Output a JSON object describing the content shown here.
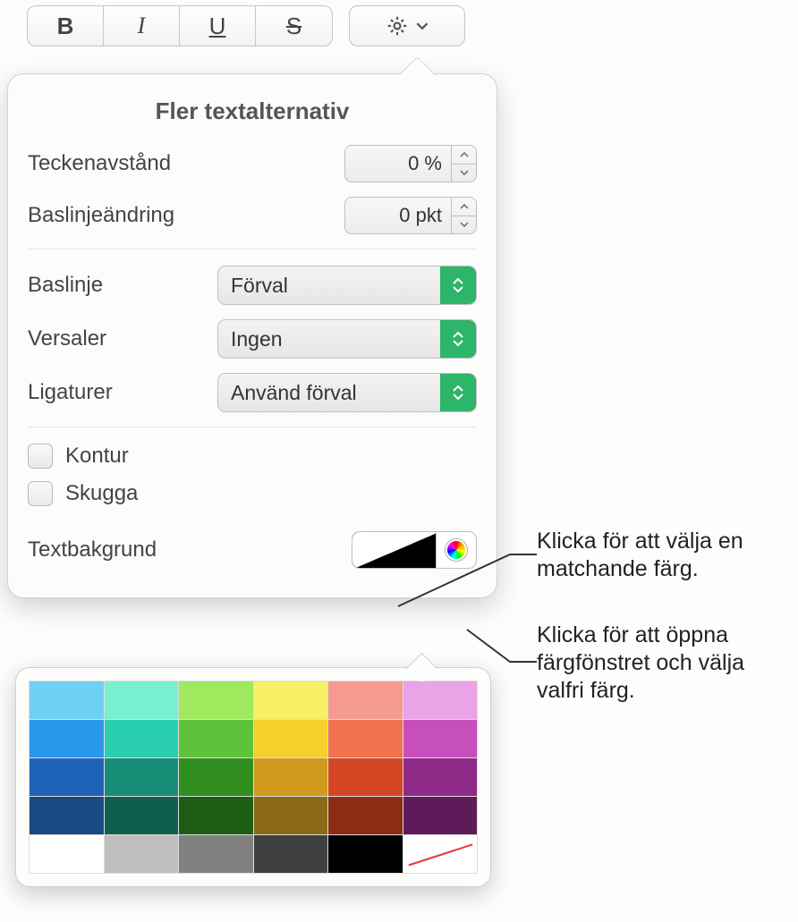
{
  "toolbar": {
    "bold_letter": "B",
    "italic_letter": "I",
    "underline_letter": "U",
    "strike_letter": "S"
  },
  "popover": {
    "title": "Fler textalternativ",
    "char_spacing_label": "Teckenavstånd",
    "char_spacing_value": "0 %",
    "baseline_shift_label": "Baslinjeändring",
    "baseline_shift_value": "0 pkt",
    "baseline_label": "Baslinje",
    "baseline_select": "Förval",
    "caps_label": "Versaler",
    "caps_select": "Ingen",
    "ligatures_label": "Ligaturer",
    "ligatures_select": "Använd förval",
    "outline_label": "Kontur",
    "shadow_label": "Skugga",
    "textbg_label": "Textbakgrund"
  },
  "callouts": {
    "matching": "Klicka för att välja en matchande färg.",
    "colorwindow": "Klicka för att öppna färgfönstret och välja valfri färg."
  },
  "swatches": [
    [
      "#6fd0f6",
      "#78f0d0",
      "#9fe95e",
      "#f8ef66",
      "#f59b8e",
      "#e9a3e6"
    ],
    [
      "#2a98ea",
      "#29cfae",
      "#5fc23b",
      "#f4d02c",
      "#f1734e",
      "#c64fbc"
    ],
    [
      "#1f63b8",
      "#178d77",
      "#2f8e1e",
      "#cf9a1f",
      "#d44524",
      "#8e2a87"
    ],
    [
      "#194a81",
      "#0f5f51",
      "#1e5e14",
      "#8a6a15",
      "#8e2c16",
      "#5e1b59"
    ],
    [
      "#ffffff",
      "#bfbfbf",
      "#808080",
      "#404040",
      "#000000",
      "none"
    ]
  ]
}
